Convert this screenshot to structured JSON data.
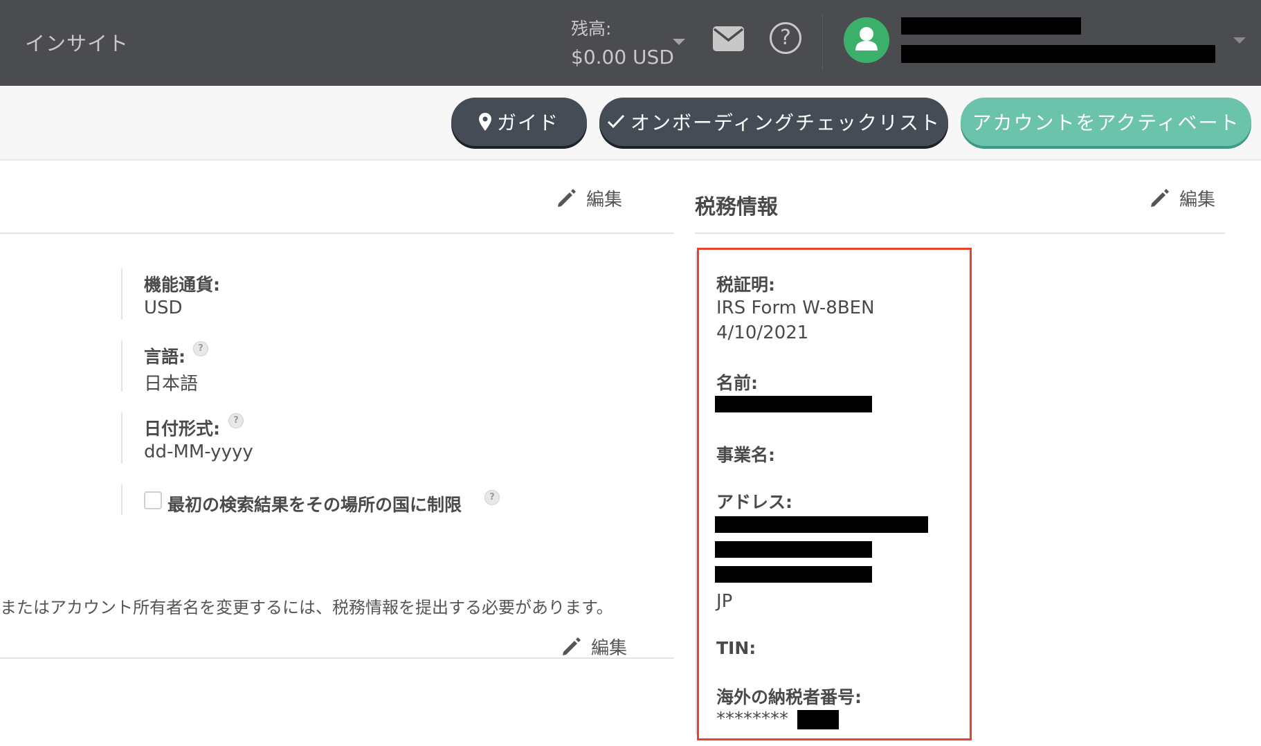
{
  "topbar": {
    "title": "インサイト",
    "balance_label": "残高:",
    "balance_value": "$0.00 USD",
    "icons": [
      "mail-icon",
      "help-icon",
      "user-icon",
      "chevron-down-icon"
    ],
    "avatar_color": "#3bb06a"
  },
  "actions": {
    "guide_label": "ガイド",
    "checklist_label": "オンボーディングチェックリスト",
    "activate_label": "アカウントをアクティベート",
    "guide_icon": "map-pin-icon",
    "checklist_icon": "check-icon"
  },
  "colors": {
    "topbar": "#4b4c50",
    "dark_button": "#454c55",
    "teal_button": "#6cc3ac",
    "highlight_border": "#e5432b"
  },
  "preferences": {
    "edit_label": "編集",
    "currency_label": "機能通貨:",
    "currency_value": "USD",
    "language_label": "言語:",
    "language_value": "日本語",
    "date_format_label": "日付形式:",
    "date_format_value": "dd-MM-yyyy",
    "restrict_search_label": "最初の検索結果をその場所の国に制限",
    "restrict_search_checked": false
  },
  "account": {
    "notice": "またはアカウント所有者名を変更するには、税務情報を提出する必要があります。",
    "edit_label": "編集"
  },
  "tax": {
    "title": "税務情報",
    "edit_label": "編集",
    "certificate_label": "税証明:",
    "certificate_form": "IRS Form W-8BEN",
    "certificate_date": "4/10/2021",
    "name_label": "名前:",
    "business_name_label": "事業名:",
    "address_label": "アドレス:",
    "address_country": "JP",
    "tin_label": "TIN:",
    "foreign_tin_label": "海外の納税者番号:",
    "foreign_tin_value": "********"
  }
}
